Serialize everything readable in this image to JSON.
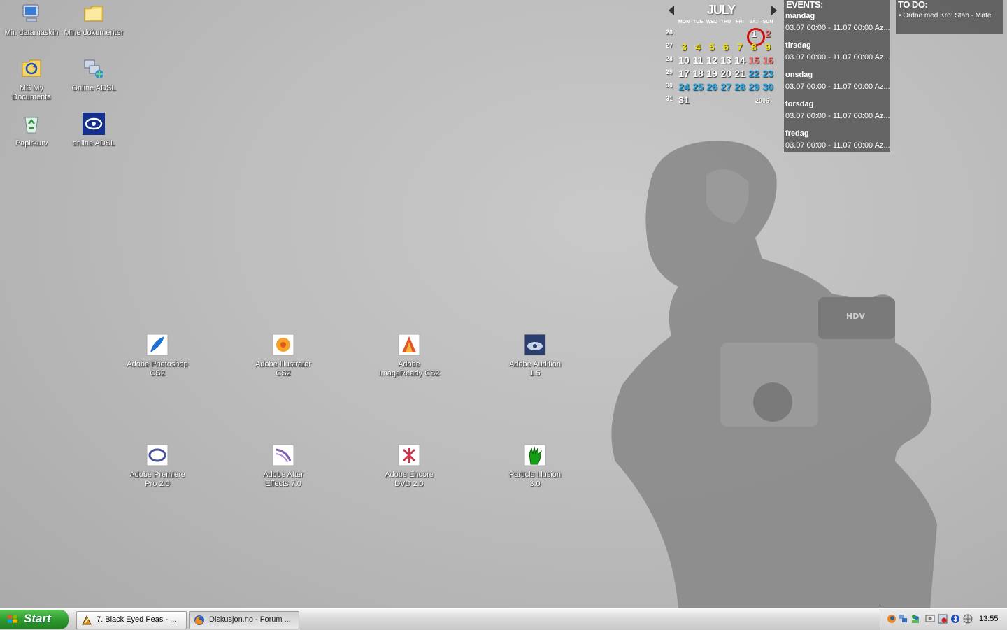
{
  "desktop_icons": [
    {
      "label": "Min datamaskin",
      "icon": "my-computer-icon"
    },
    {
      "label": "Mine dokumenter",
      "icon": "folder-icon"
    },
    {
      "label": "MS My Documents",
      "icon": "sync-folder-icon"
    },
    {
      "label": "Online ADSL",
      "icon": "network-connection-icon"
    },
    {
      "label": "Papirkurv",
      "icon": "recycle-bin-icon"
    },
    {
      "label": "online ADSL",
      "icon": "isp-logo-icon"
    },
    {
      "label": "Adobe Photoshop CS2",
      "icon": "photoshop-feather-icon"
    },
    {
      "label": "Adobe Illustrator CS2",
      "icon": "illustrator-flower-icon"
    },
    {
      "label": "Adobe ImageReady CS2",
      "icon": "imageready-icon"
    },
    {
      "label": "Adobe Audition 1.5",
      "icon": "audition-icon"
    },
    {
      "label": "Adobe Premiere Pro 2.0",
      "icon": "premiere-icon"
    },
    {
      "label": "Adobe After Effects 7.0",
      "icon": "after-effects-icon"
    },
    {
      "label": "Adobe Encore DVD 2.0",
      "icon": "encore-icon"
    },
    {
      "label": "Particle Illusion 3.0",
      "icon": "particle-illusion-hand-icon"
    }
  ],
  "calendar": {
    "month": "JULY",
    "year": "2006",
    "weekdays": [
      "MON",
      "TUE",
      "WED",
      "THU",
      "FRI",
      "SAT",
      "SUN"
    ],
    "weeks": [
      "26",
      "27",
      "28",
      "29",
      "30",
      "31"
    ],
    "days": [
      "1",
      "2",
      "3",
      "4",
      "5",
      "6",
      "7",
      "8",
      "9",
      "10",
      "11",
      "12",
      "13",
      "14",
      "15",
      "16",
      "17",
      "18",
      "19",
      "20",
      "21",
      "22",
      "23",
      "24",
      "25",
      "26",
      "27",
      "28",
      "29",
      "30",
      "31"
    ],
    "today": "1",
    "colors": {
      "highlight": "#f3e000",
      "weekend": "#ff6a6a",
      "later": "#1aa5e8",
      "today_ring": "#d01010"
    }
  },
  "events": {
    "title": "EVENTS:",
    "items": [
      {
        "day": "mandag",
        "time": "03.07 00:00 - 11.07 00:00 Az..."
      },
      {
        "day": "tirsdag",
        "time": "03.07 00:00 - 11.07 00:00 Az..."
      },
      {
        "day": "onsdag",
        "time": "03.07 00:00 - 11.07 00:00 Az..."
      },
      {
        "day": "torsdag",
        "time": "03.07 00:00 - 11.07 00:00 Az..."
      },
      {
        "day": "fredag",
        "time": "03.07 00:00 - 11.07 00:00 Az..."
      }
    ]
  },
  "todo": {
    "title": "TO DO:",
    "items": [
      "• Ordne med Kro: Stab - Møte"
    ]
  },
  "taskbar": {
    "start_label": "Start",
    "buttons": [
      {
        "label": "7. Black Eyed Peas - ...",
        "icon": "winamp-icon"
      },
      {
        "label": "Diskusjon.no - Forum ...",
        "icon": "firefox-icon"
      }
    ],
    "tray_icons": [
      "firefox-tray-icon",
      "network-tray-icon",
      "messenger-tray-icon",
      "display-tray-icon",
      "security-tray-icon",
      "bluetooth-tray-icon",
      "globe-tray-icon"
    ],
    "clock": "13:55"
  }
}
